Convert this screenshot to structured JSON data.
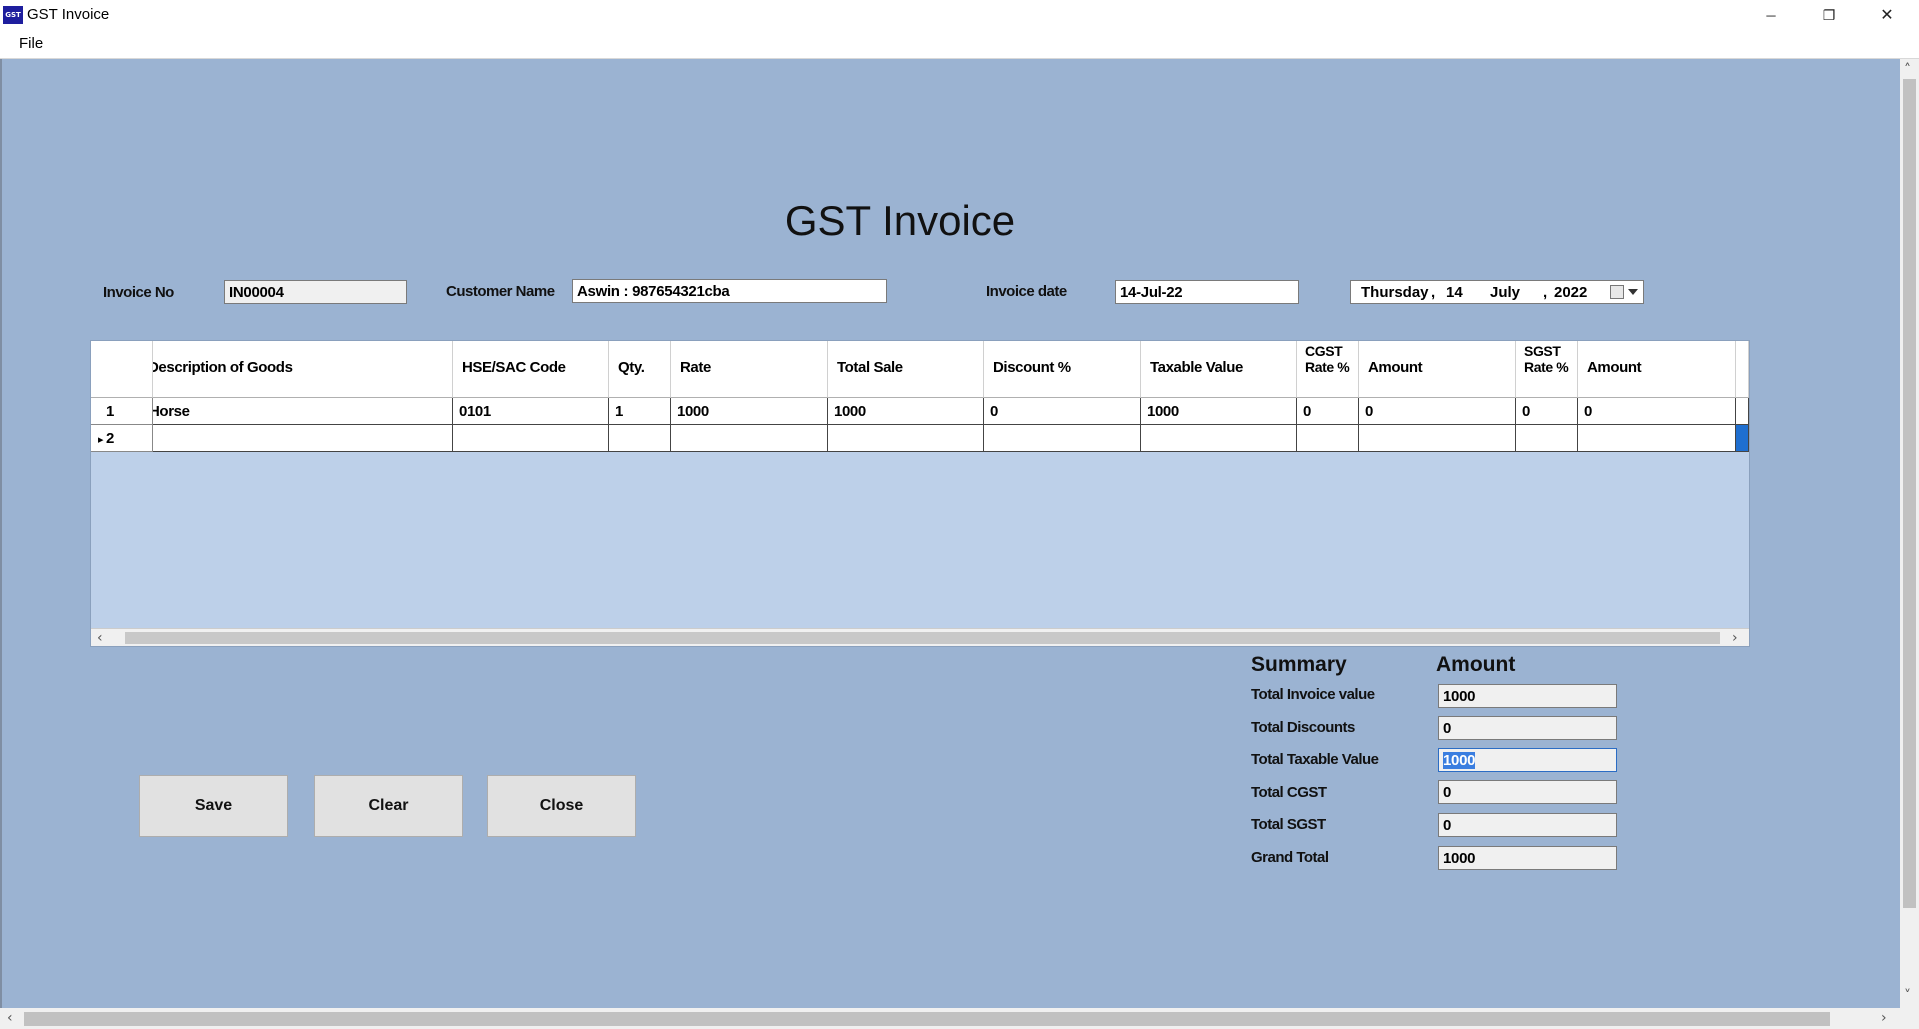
{
  "window": {
    "app_icon_text": "GST",
    "title": "GST Invoice",
    "minimize_glyph": "─",
    "restore_glyph": "❐",
    "close_glyph": "✕"
  },
  "menu": {
    "file": "File"
  },
  "form": {
    "heading": "GST Invoice",
    "invoice_no_label": "Invoice No",
    "invoice_no_value": "IN00004",
    "customer_name_label": "Customer Name",
    "customer_name_value": "Aswin : 987654321cba",
    "invoice_date_label": "Invoice date",
    "invoice_date_value": "14-Jul-22",
    "date_picker": {
      "weekday": "Thursday",
      "day": "14",
      "month": "July",
      "year": "2022"
    }
  },
  "grid": {
    "columns": [
      "Description of Goods",
      "HSE/SAC Code",
      "Qty.",
      "Rate",
      "Total Sale",
      "Discount %",
      "Taxable Value",
      "CGST Rate %",
      "Amount",
      "SGST Rate %",
      "Amount"
    ],
    "rows": [
      {
        "row_header": "1",
        "cells": [
          "Horse",
          "0101",
          "1",
          "1000",
          "1000",
          "0",
          "1000",
          "0",
          "0",
          "0",
          "0"
        ]
      },
      {
        "row_header": "2",
        "cells": [
          "",
          "",
          "",
          "",
          "",
          "",
          "",
          "",
          "",
          "",
          ""
        ]
      }
    ]
  },
  "summary": {
    "title": "Summary",
    "amount_header": "Amount",
    "items": [
      {
        "label": "Total Invoice value",
        "value": "1000"
      },
      {
        "label": "Total Discounts",
        "value": "0"
      },
      {
        "label": "Total Taxable Value",
        "value": "1000"
      },
      {
        "label": "Total CGST",
        "value": "0"
      },
      {
        "label": "Total SGST",
        "value": "0"
      },
      {
        "label": "Grand Total",
        "value": "1000"
      }
    ]
  },
  "buttons": {
    "save": "Save",
    "clear": "Clear",
    "close": "Close"
  }
}
